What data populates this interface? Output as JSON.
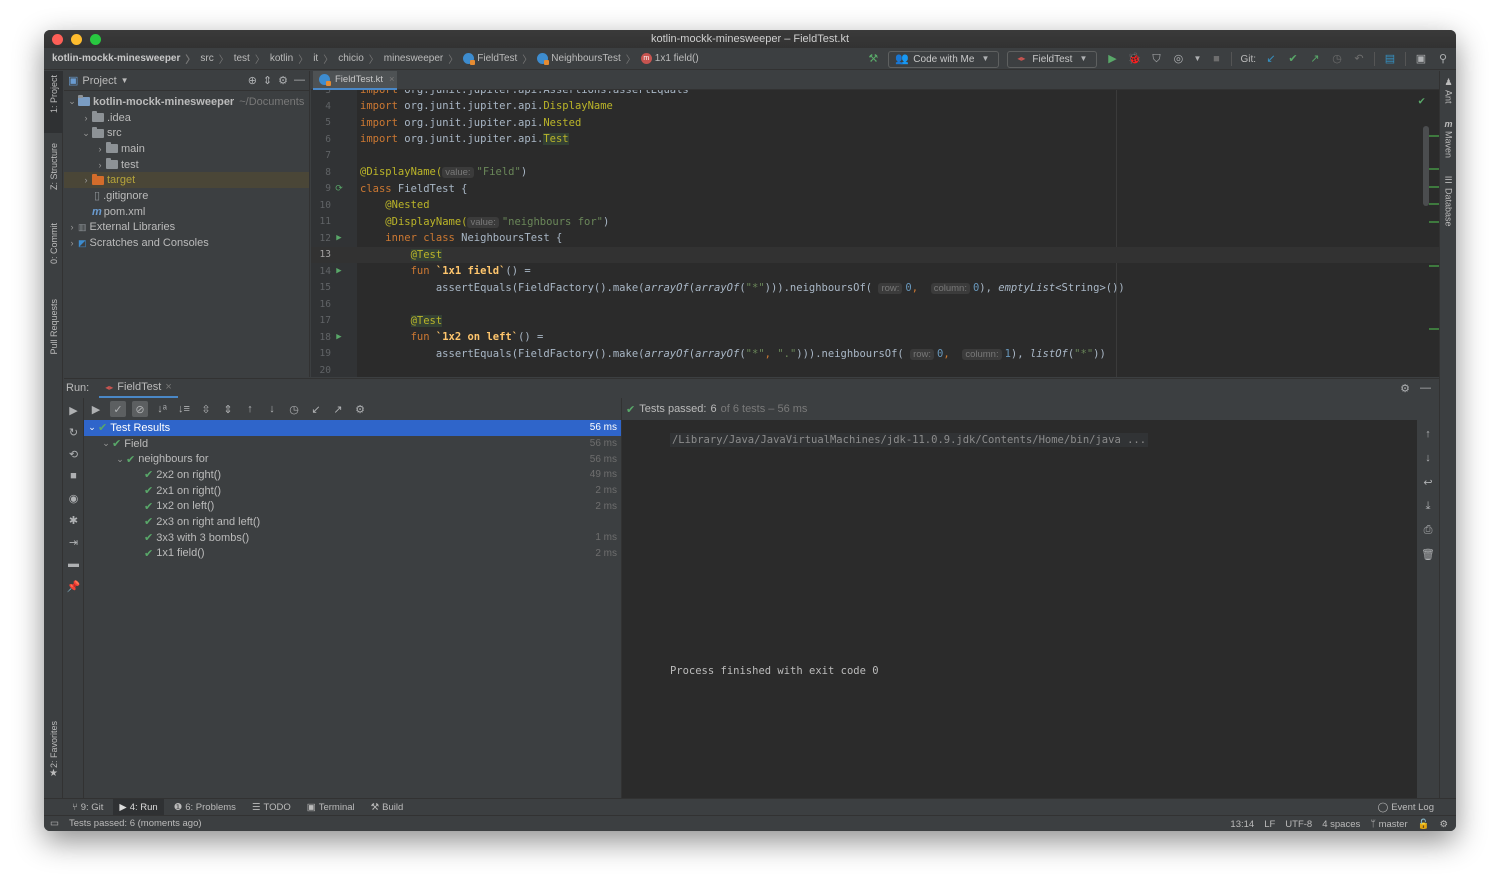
{
  "window": {
    "title": "kotlin-mockk-minesweeper – FieldTest.kt",
    "traffic_colors": [
      "#fe5f57",
      "#febc2e",
      "#28c840"
    ]
  },
  "breadcrumb": [
    {
      "label": "kotlin-mockk-minesweeper",
      "icon": ""
    },
    {
      "label": "src",
      "icon": ""
    },
    {
      "label": "test",
      "icon": ""
    },
    {
      "label": "kotlin",
      "icon": ""
    },
    {
      "label": "it",
      "icon": ""
    },
    {
      "label": "chicio",
      "icon": ""
    },
    {
      "label": "minesweeper",
      "icon": ""
    },
    {
      "label": "FieldTest",
      "icon": "kotlin-class-icon"
    },
    {
      "label": "NeighboursTest",
      "icon": "kotlin-class-icon"
    },
    {
      "label": "1x1 field()",
      "icon": "method-icon"
    }
  ],
  "toolbar": {
    "code_with_me": "Code with Me",
    "run_config": "FieldTest",
    "git_label": "Git:"
  },
  "left_stripe": {
    "project": "1: Project",
    "structure": "Z: Structure",
    "commit": "0: Commit",
    "pull_requests": "Pull Requests",
    "favorites": "2: Favorites"
  },
  "right_stripe": {
    "ant": "Ant",
    "maven": "Maven",
    "database": "Database"
  },
  "project_panel": {
    "title": "Project",
    "tree": [
      {
        "label": "kotlin-mockk-minesweeper",
        "suffix": "~/Documents",
        "depth": 0,
        "arrow": "expanded",
        "icon": "module-folder-icon",
        "bold": true
      },
      {
        "label": ".idea",
        "depth": 1,
        "arrow": "collapsed",
        "icon": "folder-icon"
      },
      {
        "label": "src",
        "depth": 1,
        "arrow": "expanded",
        "icon": "folder-icon"
      },
      {
        "label": "main",
        "depth": 2,
        "arrow": "collapsed",
        "icon": "folder-icon"
      },
      {
        "label": "test",
        "depth": 2,
        "arrow": "collapsed",
        "icon": "folder-icon"
      },
      {
        "label": "target",
        "depth": 1,
        "arrow": "collapsed",
        "icon": "excluded-folder-icon",
        "selected": true
      },
      {
        "label": ".gitignore",
        "depth": 1,
        "arrow": "",
        "icon": "ignore-file-icon"
      },
      {
        "label": "pom.xml",
        "depth": 1,
        "arrow": "",
        "icon": "maven-icon"
      },
      {
        "label": "External Libraries",
        "depth": 0,
        "arrow": "collapsed",
        "icon": "libraries-icon"
      },
      {
        "label": "Scratches and Consoles",
        "depth": 0,
        "arrow": "collapsed",
        "icon": "scratches-icon"
      }
    ]
  },
  "editor": {
    "tab": "FieldTest.kt",
    "current_line": 13,
    "lines": [
      {
        "n": "3",
        "text": "import org.junit.jupiter.api.Assertions.assertEquals"
      },
      {
        "n": "4",
        "text": "import org.junit.jupiter.api.DisplayName"
      },
      {
        "n": "5",
        "text": "import org.junit.jupiter.api.Nested"
      },
      {
        "n": "6",
        "text": "import org.junit.jupiter.api.Test"
      },
      {
        "n": "7",
        "text": ""
      },
      {
        "n": "8",
        "text": "@DisplayName( value: \"Field\")"
      },
      {
        "n": "9",
        "text": "class FieldTest {"
      },
      {
        "n": "10",
        "text": "    @Nested"
      },
      {
        "n": "11",
        "text": "    @DisplayName( value: \"neighbours for\")"
      },
      {
        "n": "12",
        "text": "    inner class NeighboursTest {"
      },
      {
        "n": "13",
        "text": "        @Test"
      },
      {
        "n": "14",
        "text": "        fun `1x1 field`() ="
      },
      {
        "n": "15",
        "text": "            assertEquals(FieldFactory().make(arrayOf(arrayOf(\"*\"))).neighboursOf( row: 0,  column: 0), emptyList<String>())"
      },
      {
        "n": "16",
        "text": ""
      },
      {
        "n": "17",
        "text": "        @Test"
      },
      {
        "n": "18",
        "text": "        fun `1x2 on left`() ="
      },
      {
        "n": "19",
        "text": "            assertEquals(FieldFactory().make(arrayOf(arrayOf(\"*\", \".\"))).neighboursOf( row: 0,  column: 1), listOf(\"*\"))"
      },
      {
        "n": "20",
        "text": ""
      }
    ],
    "tokens": {
      "import": "import",
      "pkg": "org.junit.jupiter.api.",
      "assertions_line": "org.junit.jupiter.api.Assertions.assertEquals",
      "DisplayName": "DisplayName",
      "Nested": "Nested",
      "Test": "Test",
      "ann_displayname": "@DisplayName(",
      "hint_value": "value:",
      "str_field": "\"Field\"",
      "close_paren": ")",
      "class_kw": "class",
      "class_name": " FieldTest {",
      "ann_nested": "@Nested",
      "str_neighbours": "\"neighbours for\"",
      "inner_kw": "inner class",
      "inner_name": " NeighboursTest {",
      "ann_test": "@Test",
      "fun_kw": "fun",
      "fun1": "`1x1 field`",
      "fun2": "`1x2 on left`",
      "fun_tail": "() =",
      "assert_start": "assertEquals(FieldFactory().make(",
      "arrayOf": "arrayOf",
      "open": "(",
      "str_star": "\"*\"",
      "comma_sp": ", ",
      "str_dot": "\".\"",
      "close3": "))).neighboursOf(",
      "hint_row": "row:",
      "hint_column": "column:",
      "n0": "0",
      "n1": "1",
      "comma": ",",
      "close_paren_comma": "),",
      "emptyList": "emptyList",
      "emptyList_tail": "<String>())",
      "listOf": "listOf",
      "close2": "))"
    }
  },
  "run_panel": {
    "label": "Run:",
    "tab": "FieldTest",
    "summary_label": "Tests passed:",
    "summary_count": "6",
    "summary_rest": "of 6 tests – 56 ms",
    "tests": [
      {
        "label": "Test Results",
        "time": "56 ms",
        "depth": 0,
        "arrow": "expanded",
        "selected": true
      },
      {
        "label": "Field",
        "time": "56 ms",
        "depth": 1,
        "arrow": "expanded"
      },
      {
        "label": "neighbours for",
        "time": "56 ms",
        "depth": 2,
        "arrow": "expanded"
      },
      {
        "label": "2x2 on right()",
        "time": "49 ms",
        "depth": 3
      },
      {
        "label": "2x1 on right()",
        "time": "2 ms",
        "depth": 3
      },
      {
        "label": "1x2 on left()",
        "time": "2 ms",
        "depth": 3
      },
      {
        "label": "2x3 on right and left()",
        "time": "",
        "depth": 3
      },
      {
        "label": "3x3 with 3 bombs()",
        "time": "1 ms",
        "depth": 3
      },
      {
        "label": "1x1 field()",
        "time": "2 ms",
        "depth": 3
      }
    ],
    "console_cmd": "/Library/Java/JavaVirtualMachines/jdk-11.0.9.jdk/Contents/Home/bin/java ...",
    "console_exit": "Process finished with exit code 0"
  },
  "bottom_tabs": [
    {
      "label": "9: Git",
      "icon": "git-icon"
    },
    {
      "label": "4: Run",
      "icon": "run-icon",
      "active": true
    },
    {
      "label": "6: Problems",
      "icon": "problems-icon"
    },
    {
      "label": "TODO",
      "icon": "todo-icon"
    },
    {
      "label": "Terminal",
      "icon": "terminal-icon"
    },
    {
      "label": "Build",
      "icon": "build-icon"
    }
  ],
  "event_log": "Event Log",
  "status": {
    "message": "Tests passed: 6 (moments ago)",
    "position": "13:14",
    "line_sep": "LF",
    "encoding": "UTF-8",
    "indent": "4 spaces",
    "branch": "master"
  }
}
